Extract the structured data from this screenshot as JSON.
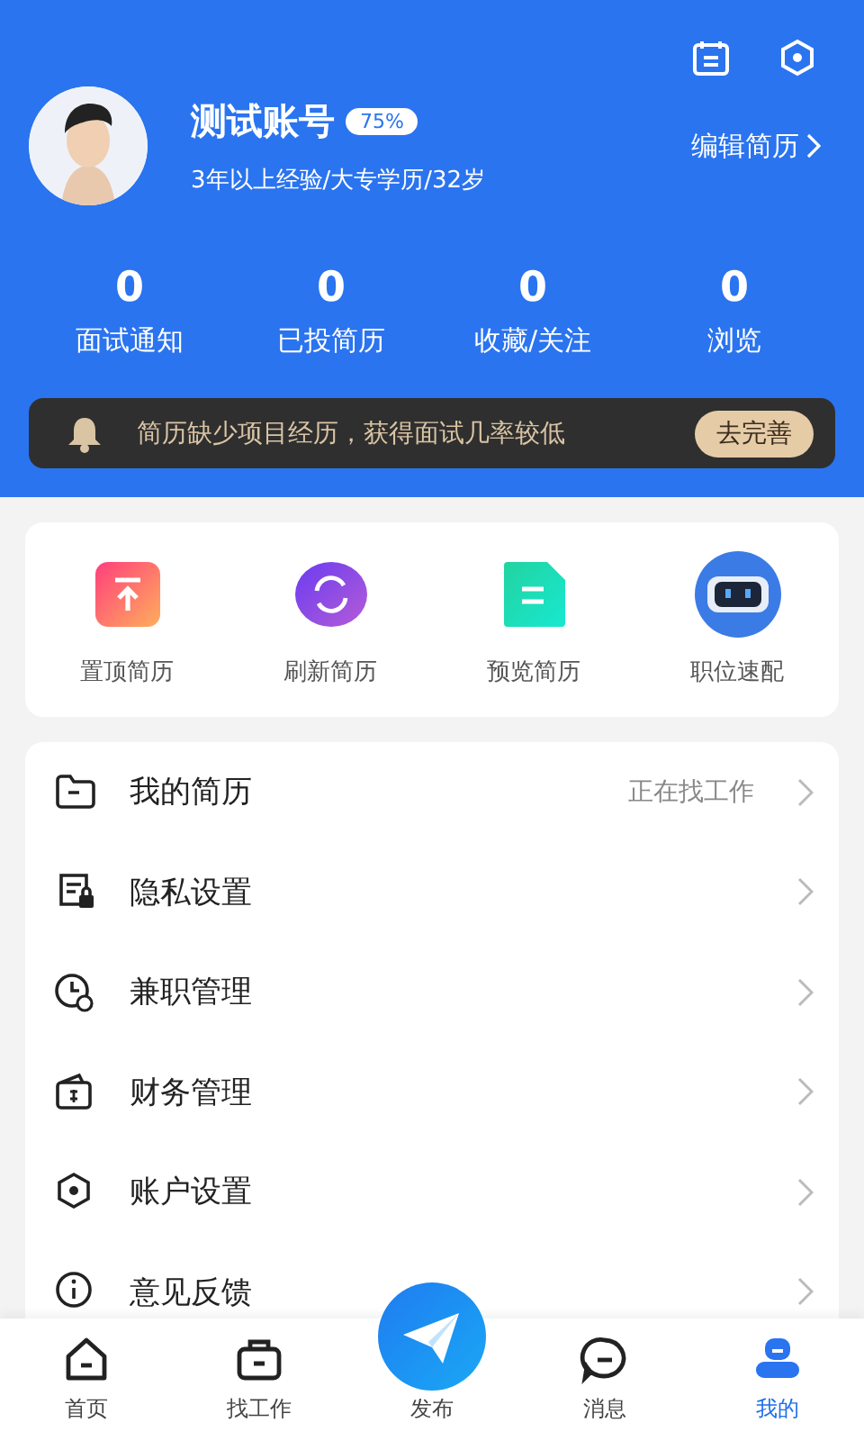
{
  "header": {
    "name": "测试账号",
    "completion": "75%",
    "summary": "3年以上经验/大专学历/32岁",
    "edit_link": "编辑简历",
    "stats": [
      {
        "value": "0",
        "label": "面试通知"
      },
      {
        "value": "0",
        "label": "已投简历"
      },
      {
        "value": "0",
        "label": "收藏/关注"
      },
      {
        "value": "0",
        "label": "浏览"
      }
    ],
    "notice": {
      "text": "简历缺少项目经历，获得面试几率较低",
      "button": "去完善"
    }
  },
  "quick_actions": [
    {
      "label": "置顶简历"
    },
    {
      "label": "刷新简历"
    },
    {
      "label": "预览简历"
    },
    {
      "label": "职位速配"
    }
  ],
  "menu": [
    {
      "label": "我的简历",
      "value": "正在找工作"
    },
    {
      "label": "隐私设置"
    },
    {
      "label": "兼职管理"
    },
    {
      "label": "财务管理"
    },
    {
      "label": "账户设置"
    },
    {
      "label": "意见反馈"
    }
  ],
  "tab_bar": [
    {
      "label": "首页",
      "selected": false
    },
    {
      "label": "找工作",
      "selected": false
    },
    {
      "label": "发布",
      "selected": false
    },
    {
      "label": "消息",
      "selected": false
    },
    {
      "label": "我的",
      "selected": true
    }
  ]
}
